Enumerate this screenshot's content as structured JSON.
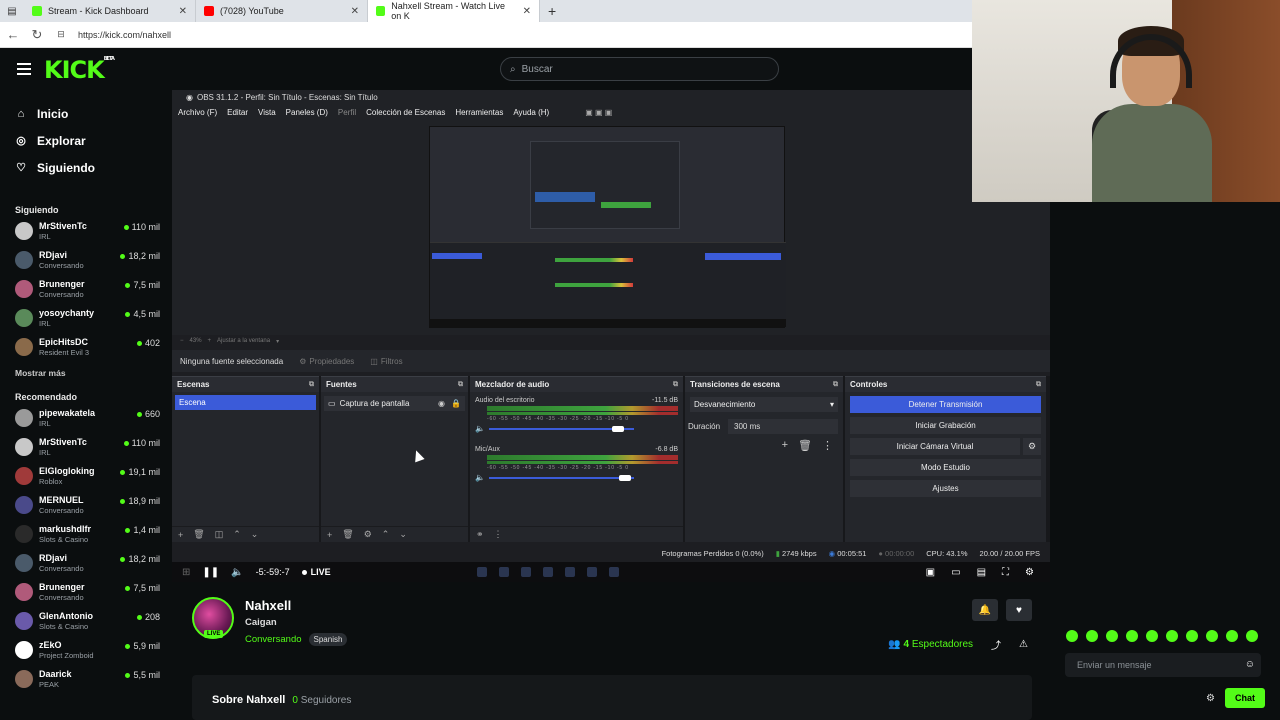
{
  "browser": {
    "tabs": [
      {
        "label": "Stream - Kick Dashboard",
        "color": "#53fc18"
      },
      {
        "label": "(7028) YouTube",
        "color": "#ff0000"
      },
      {
        "label": "Nahxell Stream - Watch Live on K",
        "color": "#53fc18"
      }
    ],
    "new_tab": "+",
    "url": "https://kick.com/nahxell"
  },
  "header": {
    "logo": "KICK",
    "logo_badge": "BETA",
    "search_placeholder": "Buscar"
  },
  "sidebar": {
    "nav": [
      {
        "label": "Inicio",
        "icon": "home-icon"
      },
      {
        "label": "Explorar",
        "icon": "compass-icon"
      },
      {
        "label": "Siguiendo",
        "icon": "heart-icon"
      }
    ],
    "following_title": "Siguiendo",
    "following": [
      {
        "name": "MrStivenTc",
        "category": "IRL",
        "viewers": "110 mil",
        "color": "#c8c8c8"
      },
      {
        "name": "RDjavi",
        "category": "Conversando",
        "viewers": "18,2 mil",
        "color": "#4a5a6a"
      },
      {
        "name": "Brunenger",
        "category": "Conversando",
        "viewers": "7,5 mil",
        "color": "#b05a7a"
      },
      {
        "name": "yosoychanty",
        "category": "IRL",
        "viewers": "4,5 mil",
        "color": "#5a8a5a"
      },
      {
        "name": "EpicHitsDC",
        "category": "Resident Evil 3",
        "viewers": "402",
        "color": "#8a6a4a"
      }
    ],
    "show_more": "Mostrar más",
    "recommended_title": "Recomendado",
    "recommended": [
      {
        "name": "pipewakatela",
        "category": "IRL",
        "viewers": "660",
        "color": "#9a9a9a"
      },
      {
        "name": "MrStivenTc",
        "category": "IRL",
        "viewers": "110 mil",
        "color": "#c8c8c8"
      },
      {
        "name": "ElGlogloking",
        "category": "Roblox",
        "viewers": "19,1 mil",
        "color": "#a03a3a"
      },
      {
        "name": "MERNUEL",
        "category": "Conversando",
        "viewers": "18,9 mil",
        "color": "#4a4a8a"
      },
      {
        "name": "markushdlfr",
        "category": "Slots & Casino",
        "viewers": "1,4 mil",
        "color": "#2a2a2a"
      },
      {
        "name": "RDjavi",
        "category": "Conversando",
        "viewers": "18,2 mil",
        "color": "#4a5a6a"
      },
      {
        "name": "Brunenger",
        "category": "Conversando",
        "viewers": "7,5 mil",
        "color": "#b05a7a"
      },
      {
        "name": "GlenAntonio",
        "category": "Slots & Casino",
        "viewers": "208",
        "color": "#6a5aaa"
      },
      {
        "name": "zEkO",
        "category": "Project Zomboid",
        "viewers": "5,9 mil",
        "color": "#ffffff"
      },
      {
        "name": "Daarick",
        "category": "PEAK",
        "viewers": "5,5 mil",
        "color": "#8a6a5a"
      }
    ]
  },
  "obs": {
    "title": "OBS 31.1.2 - Perfil: Sin Título - Escenas: Sin Título",
    "menu": [
      "Archivo (F)",
      "Editar",
      "Vista",
      "Paneles (D)",
      "Perfil",
      "Colección de Escenas",
      "Herramientas",
      "Ayuda (H)"
    ],
    "zoom": "43%",
    "zoom_fit": "Ajustar a la ventana",
    "no_source": "Ninguna fuente seleccionada",
    "properties": "Propiedades",
    "filters": "Filtros",
    "docks": {
      "scenes": {
        "title": "Escenas",
        "items": [
          "Escena"
        ]
      },
      "sources": {
        "title": "Fuentes",
        "items": [
          "Captura de pantalla"
        ]
      },
      "mixer": {
        "title": "Mezclador de audio",
        "tracks": [
          {
            "name": "Audio del escritorio",
            "db": "-11.5 dB",
            "knob_pos": 0.85
          },
          {
            "name": "Mic/Aux",
            "db": "-6.8 dB",
            "knob_pos": 0.9
          }
        ],
        "scale": "-60 -55 -50 -45 -40 -35 -30 -25 -20 -15 -10 -5 0"
      },
      "transitions": {
        "title": "Transiciones de escena",
        "type": "Desvanecimiento",
        "duration_label": "Duración",
        "duration_value": "300 ms"
      },
      "controls": {
        "title": "Controles",
        "stop_stream": "Detener Transmisión",
        "start_recording": "Iniciar Grabación",
        "virtual_cam": "Iniciar Cámara Virtual",
        "studio_mode": "Modo Estudio",
        "settings": "Ajustes"
      }
    },
    "status": {
      "dropped": "Fotogramas Perdidos 0 (0.0%)",
      "bitrate": "2749 kbps",
      "live_time": "00:05:51",
      "rec_time": "00:00:00",
      "cpu": "CPU: 43.1%",
      "fps": "20.00 / 20.00 FPS"
    }
  },
  "player": {
    "time": "-5:-59:-7",
    "live": "LIVE"
  },
  "stream": {
    "name": "Nahxell",
    "title": "Caigan",
    "category": "Conversando",
    "language": "Spanish",
    "live_badge": "LIVE",
    "viewers_count": "4",
    "viewers_label": "Espectadores",
    "about": "Sobre Nahxell",
    "followers_count": "0",
    "followers_label": "Seguidores"
  },
  "chat": {
    "placeholder": "Enviar un mensaje",
    "send": "Chat"
  },
  "colors": {
    "accent": "#53fc18",
    "obs_blue": "#3b5bd9"
  }
}
